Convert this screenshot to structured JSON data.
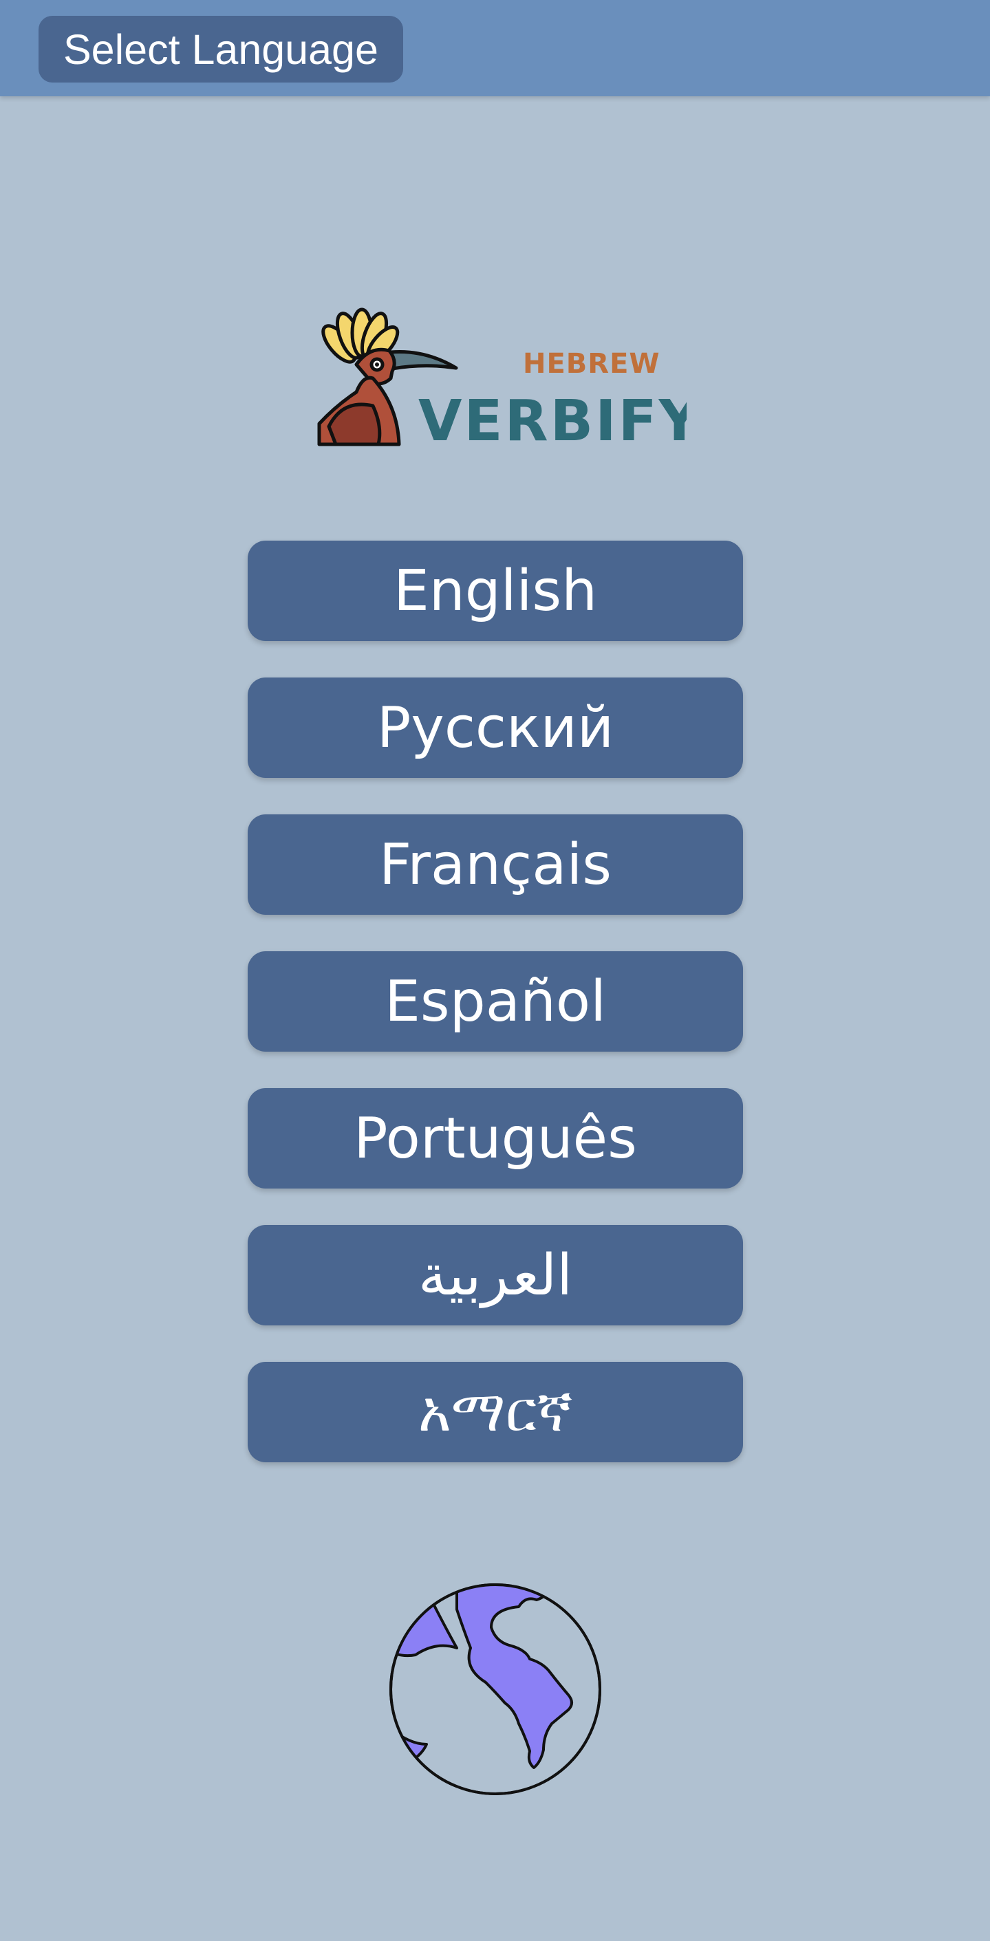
{
  "header": {
    "title": "Select Language"
  },
  "logo": {
    "subtitle": "HEBREW",
    "name": "VERBIFY"
  },
  "languages": [
    {
      "label": "English"
    },
    {
      "label": "Русский"
    },
    {
      "label": "Français"
    },
    {
      "label": "Español"
    },
    {
      "label": "Português"
    },
    {
      "label": "العربية"
    },
    {
      "label": "አማርኛ"
    }
  ],
  "icons": {
    "logo": "hoopoe-bird-icon",
    "footer": "globe-icon"
  },
  "colors": {
    "background": "#b0c1d1",
    "topbar": "#6a8fbc",
    "button": "#4a6690",
    "logo_teal": "#2e6b78",
    "logo_orange": "#c0703a",
    "globe_land": "#8b80f5"
  }
}
